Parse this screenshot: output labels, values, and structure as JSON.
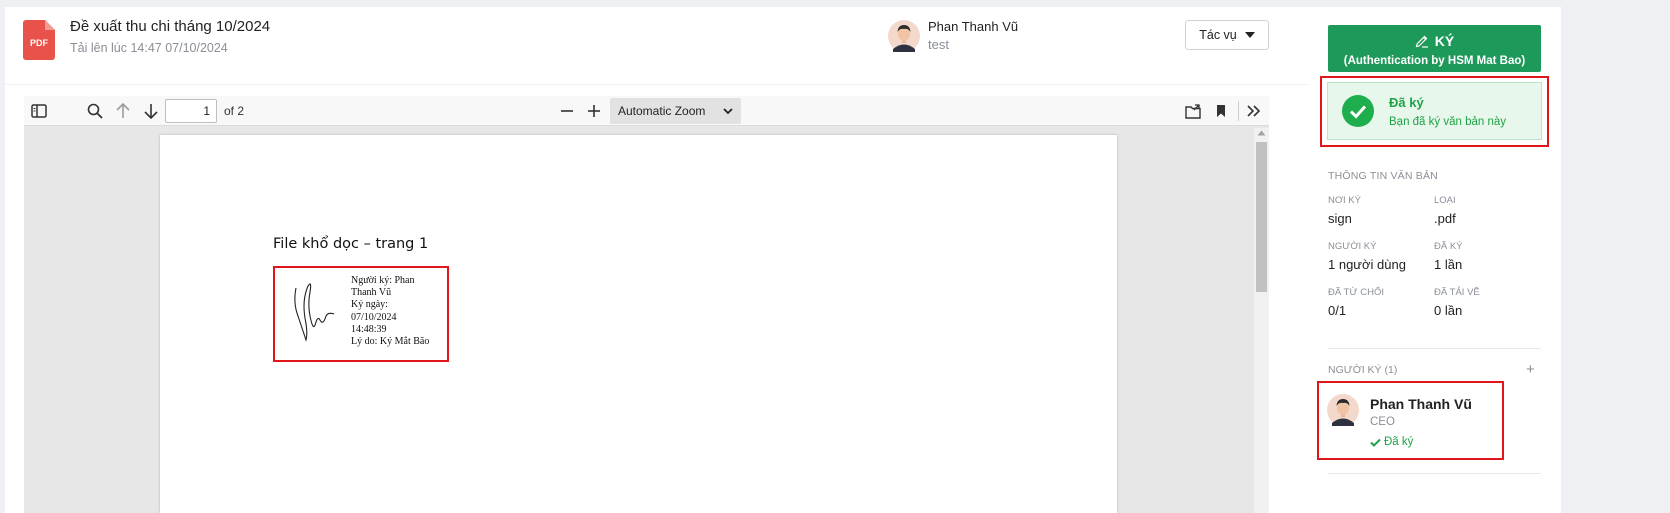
{
  "document": {
    "title": "Đề xuất thu chi tháng 10/2024",
    "uploaded": "Tải lên lúc 14:47 07/10/2024",
    "file_type_icon": "PDF"
  },
  "uploader": {
    "name": "Phan Thanh Vũ",
    "subtitle": "test"
  },
  "actions": {
    "label": "Tác vụ"
  },
  "viewer": {
    "page_number": "1",
    "page_count": "of 2",
    "zoom": "Automatic Zoom",
    "page_heading": "File khổ dọc – trang 1",
    "signature": {
      "lines": [
        "Người ký: Phan",
        "Thanh Vũ",
        "Ký ngày:",
        "07/10/2024",
        "14:48:39",
        "Lý do: Ký Mắt Bão"
      ]
    }
  },
  "sign_button": {
    "label": "KÝ",
    "sub": "(Authentication by HSM Mat Bao)"
  },
  "signed_status": {
    "title": "Đã ký",
    "message": "Bạn đã ký văn bản này"
  },
  "info": {
    "section_title": "THÔNG TIN VĂN BẢN",
    "fields": [
      {
        "label": "NƠI KÝ",
        "value": "sign"
      },
      {
        "label": "LOẠI",
        "value": ".pdf"
      },
      {
        "label": "NGƯỜI KÝ",
        "value": "1 người dùng"
      },
      {
        "label": "ĐÃ KÝ",
        "value": "1 lần"
      },
      {
        "label": "ĐÃ TỪ CHỐI",
        "value": "0/1"
      },
      {
        "label": "ĐÃ TẢI VỀ",
        "value": "0 lần"
      }
    ]
  },
  "signers": {
    "title": "NGƯỜI KÝ (1)",
    "add": "+",
    "items": [
      {
        "name": "Phan Thanh Vũ",
        "role": "CEO",
        "status": "Đã ký"
      }
    ]
  },
  "colors": {
    "primary_green": "#1d9a5a",
    "success": "#1fae4e",
    "highlight_red": "#e0161a",
    "pdf_red": "#e8524a"
  }
}
